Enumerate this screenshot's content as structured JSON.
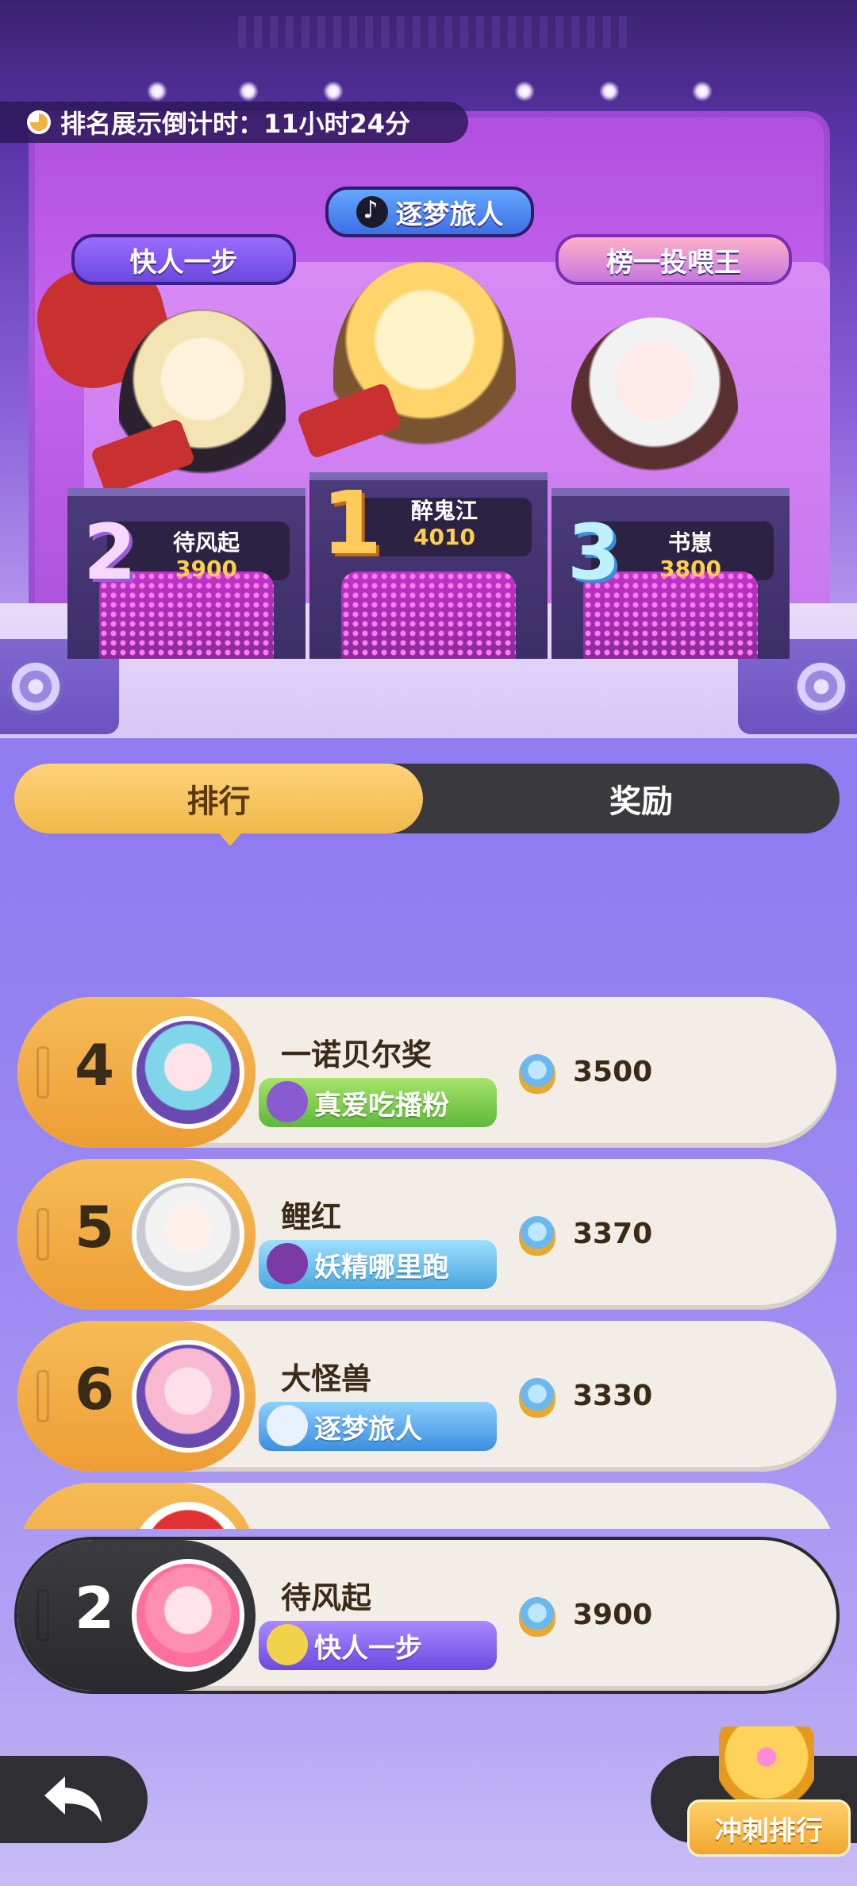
{
  "header": {
    "countdown_text": "排名展示倒计时：11小时24分"
  },
  "podium": {
    "top_badge": "逐梦旅人",
    "left_badge": "快人一步",
    "right_badge": "榜一投喂王",
    "first": {
      "rank": "1",
      "name": "醉鬼江",
      "score": "4010"
    },
    "second": {
      "rank": "2",
      "name": "待风起",
      "score": "3900"
    },
    "third": {
      "rank": "3",
      "name": "书崽",
      "score": "3800"
    }
  },
  "tabs": {
    "ranking": "排行",
    "rewards": "奖励"
  },
  "list": [
    {
      "rank": "4",
      "name": "一诺贝尔奖",
      "tag": "真爱吃播粉",
      "score": "3500"
    },
    {
      "rank": "5",
      "name": "鲤红",
      "tag": "妖精哪里跑",
      "score": "3370"
    },
    {
      "rank": "6",
      "name": "大怪兽",
      "tag": "逐梦旅人",
      "score": "3330"
    }
  ],
  "my_rank": {
    "rank": "2",
    "name": "待风起",
    "tag": "快人一步",
    "score": "3900"
  },
  "buttons": {
    "sprint": "冲刺排行"
  },
  "colors": {
    "accent_gold": "#f0b94a",
    "dark_bar": "#3a3a3e",
    "background_purple": "#8f7cf0"
  }
}
